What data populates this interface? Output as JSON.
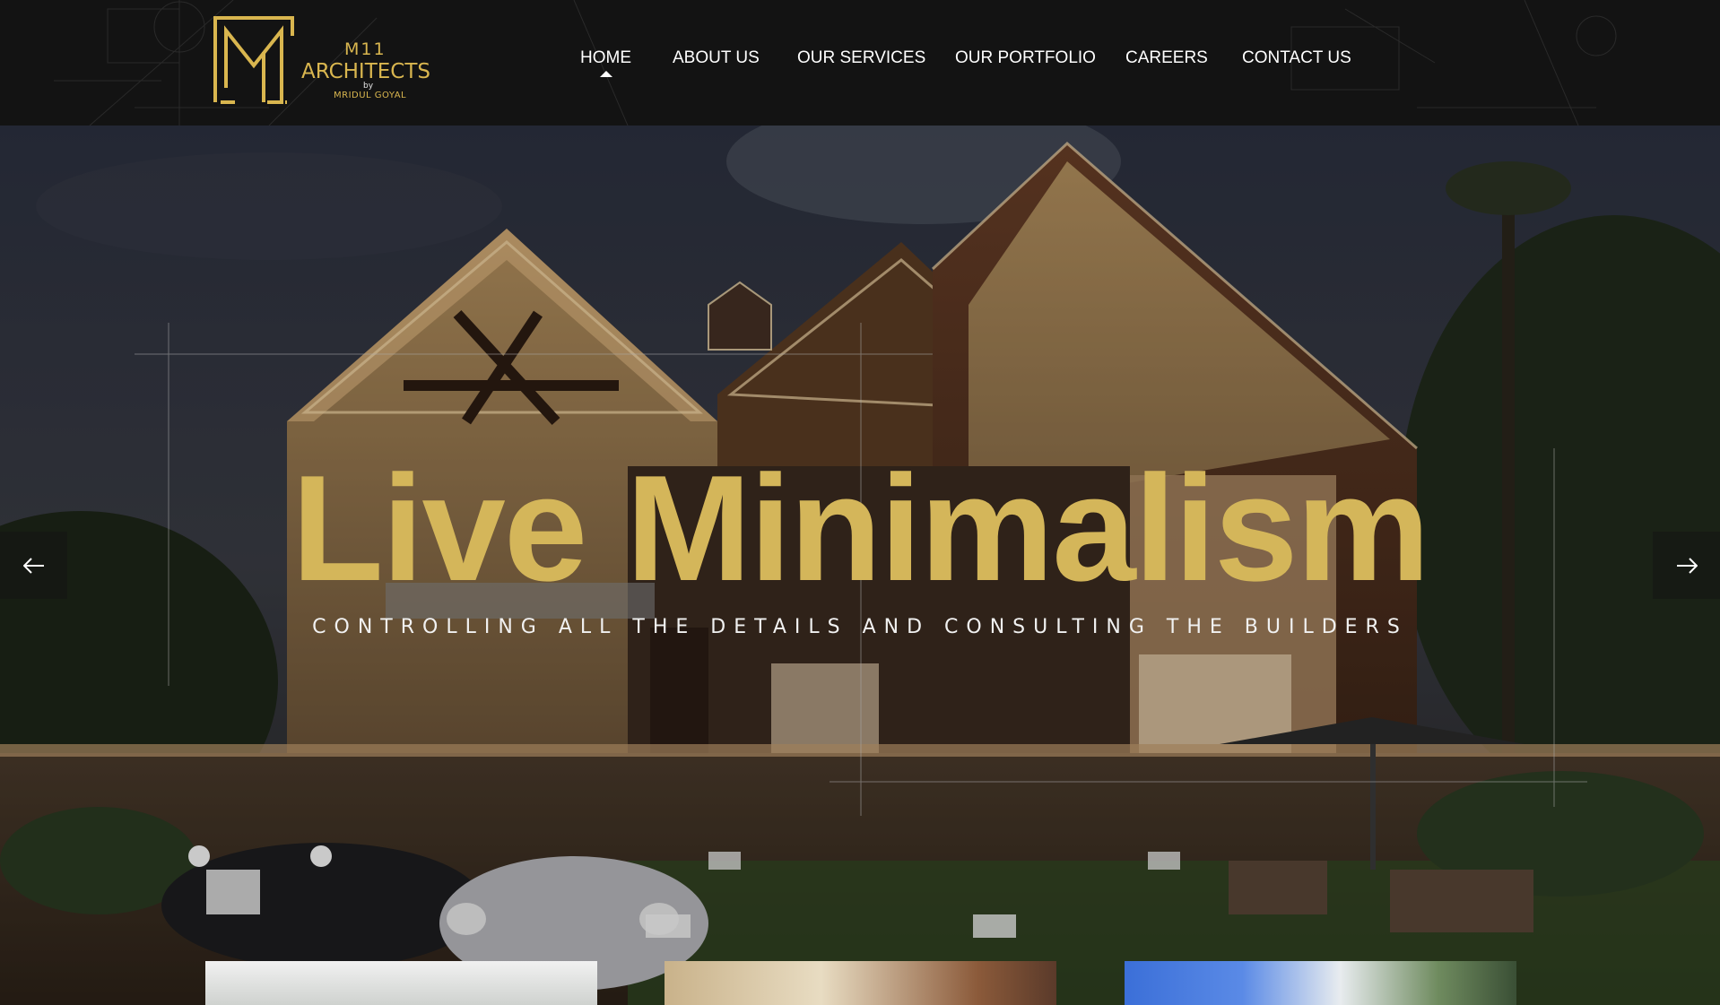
{
  "brand": {
    "line1": "M11",
    "line2": "ARCHITECTS",
    "line3": "by",
    "line4": "MRIDUL GOYAL",
    "accent_color": "#d9b64f"
  },
  "nav": {
    "items": [
      {
        "label": "HOME",
        "active": true
      },
      {
        "label": "ABOUT US"
      },
      {
        "label": "OUR SERVICES"
      },
      {
        "label": "OUR PORTFOLIO"
      },
      {
        "label": "CAREERS"
      },
      {
        "label": "CONTACT US"
      }
    ]
  },
  "hero": {
    "title": "Live Minimalism",
    "subtitle": "CONTROLLING ALL THE DETAILS AND CONSULTING THE BUILDERS",
    "title_color": "#d4b65a",
    "prev_icon": "arrow-left-icon",
    "next_icon": "arrow-right-icon"
  },
  "cards": [
    {
      "icon": "project-thumbnail-1"
    },
    {
      "icon": "project-thumbnail-2"
    },
    {
      "icon": "project-thumbnail-3"
    }
  ]
}
